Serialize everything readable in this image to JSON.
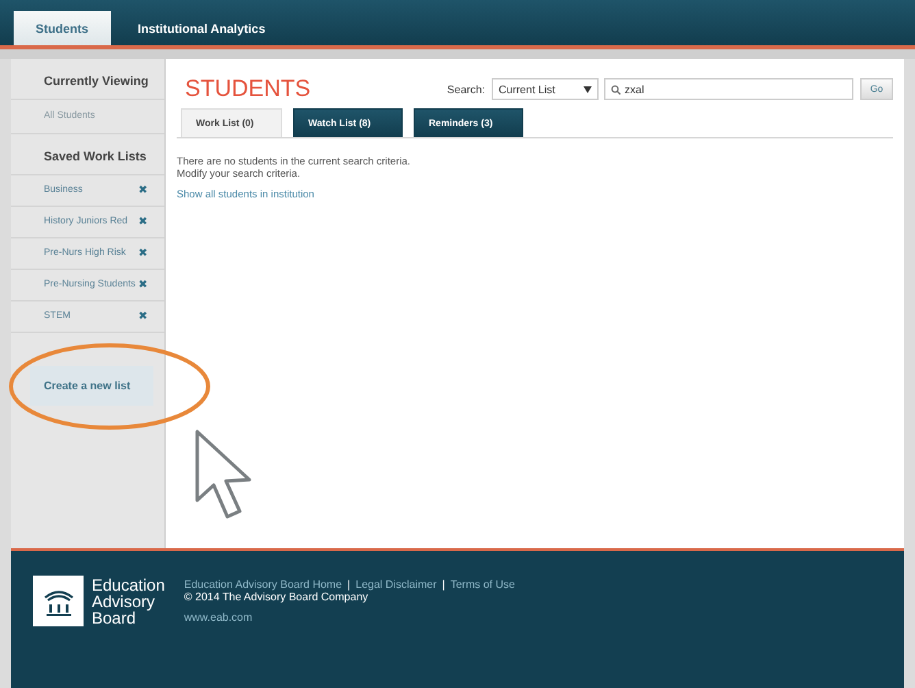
{
  "top_tabs": [
    {
      "label": "Students",
      "selected": true
    },
    {
      "label": "Institutional Analytics",
      "selected": false
    }
  ],
  "sidebar": {
    "currently_viewing_heading": "Currently Viewing",
    "current_view": "All Students",
    "saved_heading": "Saved Work Lists",
    "lists": [
      {
        "label": "Business",
        "remove_icon": "✖"
      },
      {
        "label": "History Juniors Red",
        "remove_icon": "✖"
      },
      {
        "label": "Pre-Nurs High Risk",
        "remove_icon": "✖"
      },
      {
        "label": "Pre-Nursing Students",
        "remove_icon": "✖"
      },
      {
        "label": "STEM",
        "remove_icon": "✖"
      }
    ],
    "create_link": "Create a new list"
  },
  "main": {
    "title": "STUDENTS",
    "search_label": "Search:",
    "search_scope": "Current List",
    "search_value": "zxal",
    "go_button": "Go",
    "tabs": [
      {
        "label": "Work List (0)",
        "selected": true
      },
      {
        "label": "Watch List (8)",
        "selected": false
      },
      {
        "label": "Reminders (3)",
        "selected": false
      }
    ],
    "messages": [
      "There are no students in the current search criteria.",
      "Modify your search criteria."
    ],
    "show_all_link": "Show all students in institution"
  },
  "footer": {
    "link_separator": "|",
    "logo_lines": [
      "Education",
      "Advisory",
      "Board"
    ],
    "links": [
      "Education Advisory Board Home",
      "Legal Disclaimer",
      "Terms of Use"
    ],
    "copyright": "© 2014 The Advisory Board Company",
    "website": "www.eab.com"
  }
}
